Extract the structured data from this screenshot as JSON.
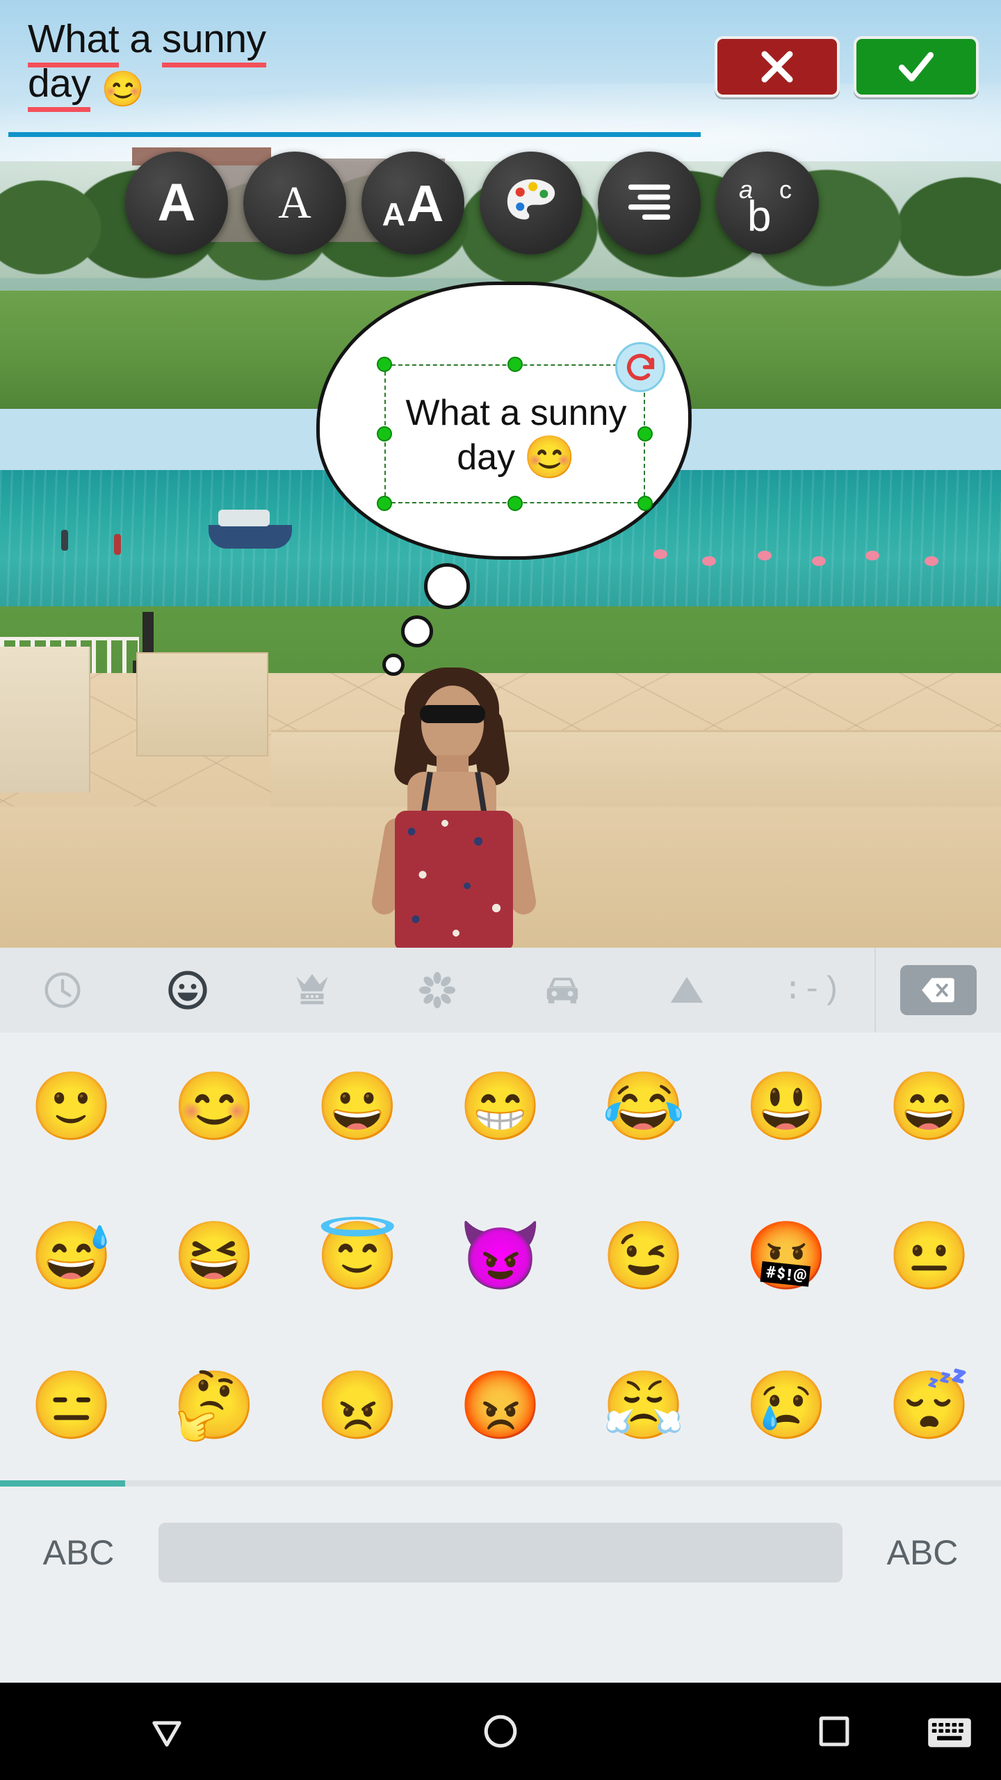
{
  "app": {
    "name": "photo-text-editor"
  },
  "text_editor": {
    "line1_word1": "What",
    "line1_word2": " a ",
    "line1_word3": "sunny",
    "line2_word1": "day",
    "line2_emoji": "😊",
    "full_text": "What a sunny day 😊",
    "misspelled_words": [
      "What",
      "sunny",
      "day"
    ],
    "underline_color": "#0e93c9",
    "spellcheck_color": "#f4505a",
    "cancel_button": {
      "label": "✕",
      "name": "cancel",
      "color": "#a31f1f"
    },
    "accept_button": {
      "label": "✓",
      "name": "accept",
      "color": "#13941f"
    }
  },
  "format_toolbar": {
    "buttons": [
      {
        "icon": "font-a-icon",
        "label": "A",
        "name": "font-family"
      },
      {
        "icon": "font-style-a-icon",
        "label": "A",
        "name": "font-style"
      },
      {
        "icon": "font-size-aa-icon",
        "label": "AA",
        "name": "font-size"
      },
      {
        "icon": "color-palette-icon",
        "label": "",
        "name": "text-color"
      },
      {
        "icon": "text-align-icon",
        "label": "",
        "name": "text-align"
      },
      {
        "icon": "letter-case-abc-icon",
        "label": "abc",
        "name": "letter-case"
      }
    ],
    "palette_colors": [
      "#e03a3a",
      "#f2c300",
      "#2f9e3f",
      "#1f7ad6",
      "#ffffff"
    ]
  },
  "sticker": {
    "type": "thought-bubble",
    "text_line1": "What a sunny",
    "text_line2": "day",
    "emoji": "😊",
    "selected": true,
    "handle_color": "#15c315",
    "selection_border_color": "#2b7a2b",
    "rotate_icon": "rotate-handle-icon",
    "rotate_bg": "#bfe6f5"
  },
  "keyboard": {
    "categories": [
      {
        "name": "recent",
        "icon": "clock-icon",
        "active": false
      },
      {
        "name": "smileys",
        "icon": "smiley-icon",
        "active": true
      },
      {
        "name": "objects",
        "icon": "crown-icon",
        "active": false
      },
      {
        "name": "nature",
        "icon": "flower-icon",
        "active": false
      },
      {
        "name": "travel",
        "icon": "car-icon",
        "active": false
      },
      {
        "name": "symbols",
        "icon": "triangle-icon",
        "active": false
      },
      {
        "name": "emoticons",
        "icon": "emoticon-text-icon",
        "active": false,
        "label": ":-)"
      }
    ],
    "backspace": {
      "icon": "backspace-icon",
      "name": "backspace-key"
    },
    "emoji_rows": [
      [
        "🙂",
        "😊",
        "😀",
        "😁",
        "😂",
        "😃",
        "😄"
      ],
      [
        "😅",
        "😆",
        "😇",
        "😈",
        "😉",
        "🤬",
        "😐"
      ],
      [
        "😑",
        "🤔",
        "😠",
        "😡",
        "😤",
        "😢",
        "😴"
      ]
    ],
    "scroll_indicator_color": "#45b3a8",
    "bottom_left_label": "ABC",
    "bottom_right_label": "ABC",
    "space_key_name": "space-key"
  },
  "navbar": {
    "back": {
      "icon": "back-triangle-icon",
      "name": "back-button"
    },
    "home": {
      "icon": "home-circle-icon",
      "name": "home-button"
    },
    "recents": {
      "icon": "recents-square-icon",
      "name": "recents-button"
    },
    "keyboard_indicator": {
      "icon": "keyboard-icon",
      "name": "keyboard-indicator"
    }
  }
}
